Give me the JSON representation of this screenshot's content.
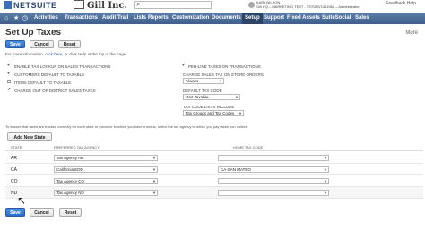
{
  "header": {
    "logo_text": "NETSUITE",
    "company_name": "Gill Inc.",
    "user_name": "KARL NILSON",
    "user_detail": "Gill HQ – MARKETING TEST - TSTDRV1311982 – Administrator",
    "top_links": "Feedback  Help"
  },
  "nav": {
    "items": [
      "Activities",
      "Transactions",
      "Audit Trail",
      "Lists",
      "Reports",
      "Customization",
      "Documents",
      "Setup",
      "Support",
      "Fixed Assets",
      "SuiteSocial",
      "Sales"
    ]
  },
  "page": {
    "title": "Set Up Taxes",
    "more_label": "More",
    "save_label": "Save",
    "cancel_label": "Cancel",
    "reset_label": "Reset",
    "help_prefix": "For more information, ",
    "help_link": "click here",
    "help_suffix": ", or click Help at the top of the page."
  },
  "options_left": [
    {
      "label": "ENABLE TAX LOOKUP ON SALES TRANSACTIONS",
      "checked": true
    },
    {
      "label": "CUSTOMERS DEFAULT TO TAXABLE",
      "checked": true
    },
    {
      "label": "ITEMS DEFAULT TO TAXABLE",
      "checked": false
    },
    {
      "label": "CHARGE OUT OF DISTRICT SALES TAXES",
      "checked": true
    }
  ],
  "options_right": {
    "per_line": {
      "label": "PER-LINE TAXES ON TRANSACTIONS",
      "checked": true
    },
    "store_orders_label": "CHARGE SALES TAX ON STORE ORDERS",
    "store_orders_value": "Always",
    "default_tax_code_label": "DEFAULT TAX CODE",
    "default_tax_code_value": "-Not Taxable-",
    "tax_code_lists_label": "TAX CODE LISTS INCLUDE",
    "tax_code_lists_value": "Tax Groups and Tax Codes"
  },
  "table": {
    "note": "To ensure that taxes are tracked correctly for each state or province in which you have a nexus, select the tax agency to which you pay taxes you collect.",
    "add_button": "Add New State",
    "col_state": "STATE",
    "col_agency": "PREFERRED TAX AGENCY",
    "col_home": "HOME TAX CODE",
    "rows": [
      {
        "state": "AR",
        "agency": "Tax Agency AR",
        "home": ""
      },
      {
        "state": "CA",
        "agency": "California EDD",
        "home": "CA-SAN MATEO"
      },
      {
        "state": "CO",
        "agency": "Tax Agency CO",
        "home": ""
      },
      {
        "state": "ND",
        "agency": "Tax Agency ND",
        "home": ""
      }
    ]
  },
  "icons": {
    "search": "search-icon",
    "home": "home-icon",
    "star": "star-icon",
    "user": "user-icon"
  }
}
